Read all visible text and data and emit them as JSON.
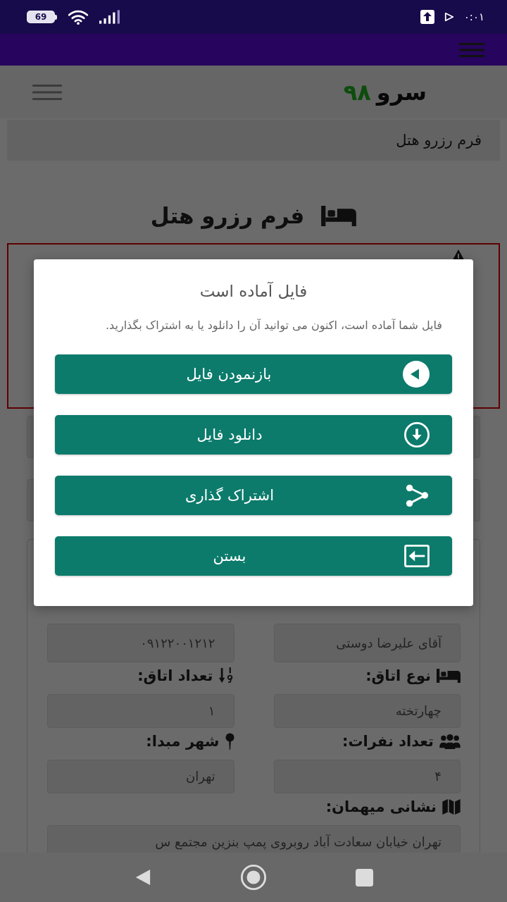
{
  "status_bar": {
    "battery": "69",
    "time": "۰:۰۱"
  },
  "header": {
    "logo_word": "سرو",
    "logo_number": "۹۸"
  },
  "breadcrumb": "فرم رزرو هتل",
  "page_title": "فرم رزرو هتل",
  "form": {
    "top_fields": [
      {
        "value": "آقای علیرضا دوستی"
      },
      {
        "value": "۰۹۱۲۲۰۰۱۲۱۲"
      }
    ],
    "fields": [
      {
        "kind": "room_type",
        "label": "نوع اتاق:",
        "value": "چهارتخته"
      },
      {
        "kind": "room_count",
        "label": "تعداد اتاق:",
        "value": "۱"
      },
      {
        "kind": "guests",
        "label": "تعداد نفرات:",
        "value": "۴"
      },
      {
        "kind": "origin_city",
        "label": "شهر مبدا:",
        "value": "تهران"
      }
    ],
    "address": {
      "label": "نشانی میهمان:",
      "value": "تهران خیابان سعادت آباد روبروی پمپ بنزین مجتمع س"
    }
  },
  "dialog": {
    "title": "فایل آماده است",
    "message": "فایل شما آماده است، اکنون می توانید آن را دانلود یا به اشتراک بگذارید.",
    "buttons": [
      {
        "kind": "open",
        "label": "بازنمودن فایل"
      },
      {
        "kind": "download",
        "label": "دانلود فایل"
      },
      {
        "kind": "share",
        "label": "اشتراک گذاری"
      },
      {
        "kind": "close",
        "label": "بستن"
      }
    ]
  }
}
